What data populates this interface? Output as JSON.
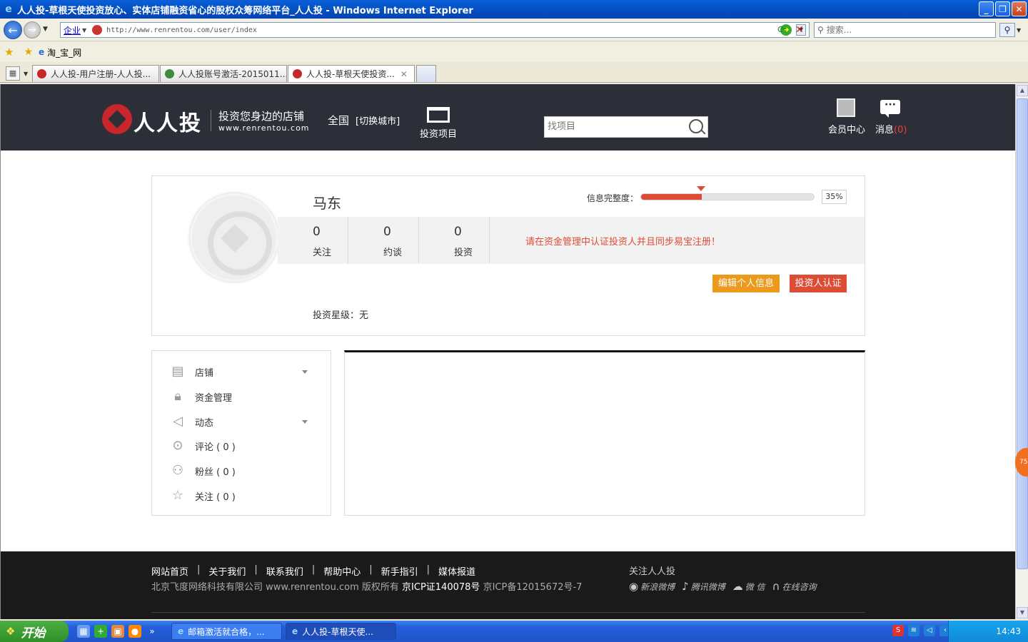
{
  "window": {
    "title": "人人投-草根天使投资放心、实体店铺融资省心的股权众筹网络平台_人人投 - Windows Internet Explorer",
    "icon": "ie-icon"
  },
  "addressbar": {
    "zone": "企业",
    "url": "http://www.renrentou.com/user/index",
    "search_placeholder": "搜索..."
  },
  "favorites": {
    "links": [
      {
        "label": "淘_宝_网"
      }
    ]
  },
  "tabs": [
    {
      "label": "人人投-用户注册-人人投...",
      "color": "#c62828"
    },
    {
      "label": "人人投账号激活-2015011...",
      "color": "#3f8b3f"
    },
    {
      "label": "人人投-草根天使投资...",
      "color": "#c62828"
    }
  ],
  "site": {
    "logo_name": "人人投",
    "slogan": "投资您身边的店铺",
    "domain": "www.renrentou.com",
    "region": "全国",
    "region_switch": "[切换城市]",
    "nav_projects": "投资项目",
    "search_placeholder": "找项目",
    "member_center": "会员中心",
    "messages_label": "消息",
    "messages_count": "(0)"
  },
  "profile": {
    "name": "马东",
    "completeness_label": "信息完整度：",
    "completeness_percent": 35,
    "completeness_text": "35%",
    "stats": [
      {
        "value": "0",
        "label": "关注"
      },
      {
        "value": "0",
        "label": "约谈"
      },
      {
        "value": "0",
        "label": "投资"
      }
    ],
    "notice": "请在资金管理中认证投资人并且同步易宝注册！",
    "edit_button": "编辑个人信息",
    "verify_button": "投资人认证",
    "star_level": "投资星级：无"
  },
  "menu": [
    {
      "label": "店铺",
      "icon": "shop-icon",
      "dropdown": true
    },
    {
      "label": "资金管理",
      "icon": "lock-icon",
      "dropdown": false
    },
    {
      "label": "动态",
      "icon": "speaker-icon",
      "dropdown": true
    },
    {
      "label": "评论 ( 0 )",
      "icon": "comment-icon",
      "dropdown": false
    },
    {
      "label": "粉丝 ( 0 )",
      "icon": "users-icon",
      "dropdown": false
    },
    {
      "label": "关注 ( 0 )",
      "icon": "star-icon",
      "dropdown": false
    }
  ],
  "footer": {
    "links": [
      "网站首页",
      "关于我们",
      "联系我们",
      "帮助中心",
      "新手指引",
      "媒体报道"
    ],
    "copyright_prefix": "北京飞度网络科技有限公司 www.renrentou.com 版权所有",
    "icp": "京ICP证140078号",
    "icp_record": "京ICP备12015672号-7",
    "follow_title": "关注人人投",
    "social": [
      "新浪微博",
      "腾讯微博",
      "微 信",
      "在线咨询"
    ],
    "float_badge": "75"
  },
  "taskbar": {
    "start": "开始",
    "tasks": [
      {
        "label": "邮箱激活就合格，..."
      },
      {
        "label": "人人投-草根天使..."
      }
    ],
    "clock": "14:43"
  },
  "colors": {
    "header_bg": "#2d2f38",
    "accent_red": "#dd4c35",
    "accent_orange": "#eb9a1b",
    "footer_bg": "#1a1a1a"
  }
}
